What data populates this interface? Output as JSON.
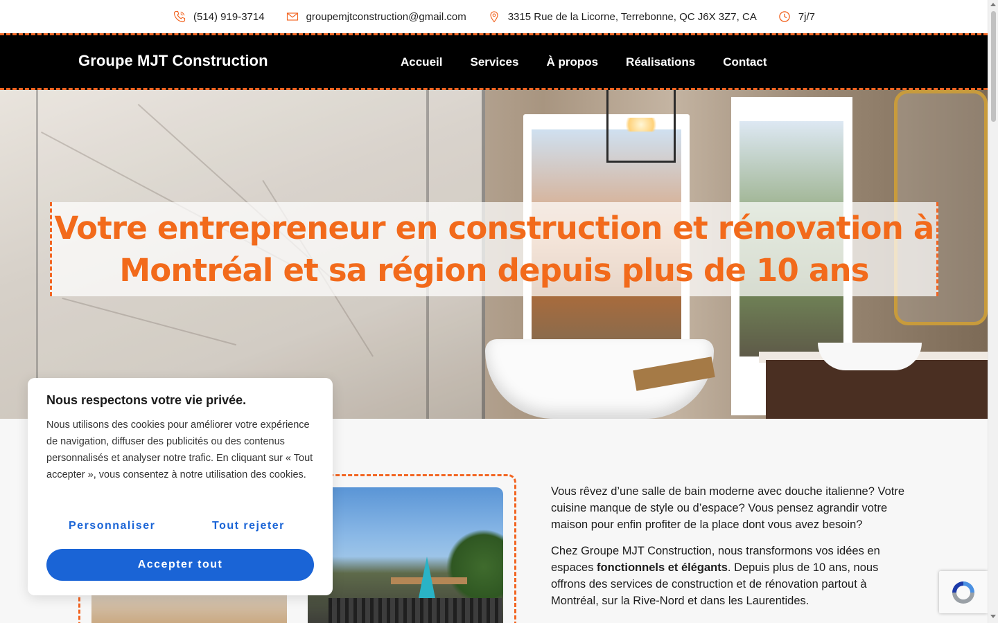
{
  "topbar": {
    "phone": "(514) 919-3714",
    "email": "groupemjtconstruction@gmail.com",
    "address": "3315 Rue de la Licorne, Terrebonne, QC J6X 3Z7, CA",
    "hours": "7j/7",
    "icon_color": "#f26522"
  },
  "nav": {
    "brand": "Groupe MJT Construction",
    "items": [
      {
        "label": "Accueil"
      },
      {
        "label": "Services"
      },
      {
        "label": "À propos"
      },
      {
        "label": "Réalisations"
      },
      {
        "label": "Contact"
      }
    ]
  },
  "hero": {
    "title": "Votre entrepreneur en construction et rénovation à Montréal et sa région depuis plus de 10 ans",
    "accent": "#f26a1b"
  },
  "content": {
    "p1": "Vous rêvez d’une salle de bain moderne avec douche italienne? Votre cuisine manque de style ou d’espace? Vous pensez agrandir votre maison pour enfin profiter de la place dont vous avez besoin?",
    "p2_before": "Chez Groupe MJT Construction, nous transformons vos idées en espaces ",
    "p2_strong": "fonctionnels et élégants",
    "p2_after": ". Depuis plus de 10 ans, nous offrons des services de construction et de rénovation partout à Montréal, sur la Rive-Nord et dans les Laurentides."
  },
  "cookie": {
    "title": "Nous respectons votre vie privée.",
    "body": "Nous utilisons des cookies pour améliorer votre expérience de navigation, diffuser des publicités ou des contenus personnalisés et analyser notre trafic. En cliquant sur « Tout accepter », vous consentez à notre utilisation des cookies.",
    "customize": "Personnaliser",
    "reject": "Tout rejeter",
    "accept": "Accepter tout",
    "button_color": "#1a64d6"
  }
}
